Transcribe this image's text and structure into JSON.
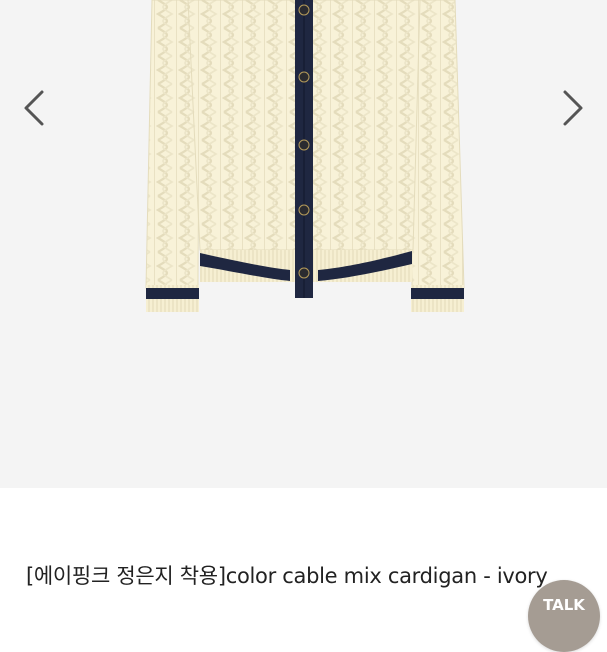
{
  "gallery": {
    "product_image": {
      "alt": "color cable mix cardigan - ivory",
      "knit_color": "#f8f2d8",
      "trim_color": "#1f2741",
      "button_color": "#2b2b30"
    },
    "prev_icon": "chevron-left-icon",
    "next_icon": "chevron-right-icon"
  },
  "product": {
    "title": "[에이핑크 정은지 착용]color cable mix cardigan - ivory"
  },
  "talk_button": {
    "label": "TALK",
    "color": "#a59c93"
  }
}
